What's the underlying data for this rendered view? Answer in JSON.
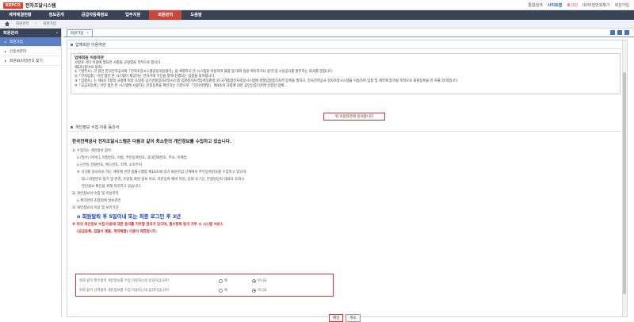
{
  "header": {
    "logo_badge": "KEPCO",
    "logo_text": "전자조달시스템",
    "integrated_search": "통합검색",
    "sitemap": "사이트맵",
    "login": "로그인",
    "find_id": "ID/비밀번호찾기",
    "join": "회원가입"
  },
  "gnb": [
    {
      "label": "계약체결현황"
    },
    {
      "label": "정보공개"
    },
    {
      "label": "공급자등록정보"
    },
    {
      "label": "업무지원"
    },
    {
      "label": "회원관리"
    },
    {
      "label": "도움말"
    }
  ],
  "breadcrumb": {
    "level1": "회원관리",
    "level2": "회원가입"
  },
  "sidebar": {
    "title": "회원관리",
    "items": [
      {
        "label": "회원가입"
      },
      {
        "label": "인증서관리"
      },
      {
        "label": "회원ID/비밀번호 찾기"
      }
    ]
  },
  "tab": {
    "label": "회원가입",
    "close": "✕"
  },
  "terms_section": {
    "title": "업체회원 이용약관",
    "body_title": "업체회원 이용약관",
    "lines": [
      "사항과 기타 이용에 필요한 사항을 규정함을 목적으로 합니다.",
      "제2조(용어의 정의)",
      "①「발주사」라 함은 한국전력공사와「전자조달시스템공동이용협약」을 체결하고 본 시스템을 이용하여 물품 및 대화 용용 획득하거나 용역 및 시설공사를 발주하는 회사를 말합니다.",
      "②「전자입찰」이란 협은 본 시스템이 제공하는 전자거래 수단을 통해 진행되는 입찰을 의미합니다.",
      "③「입찰자」는 제4조 5항의 규정에 따라 조달청 공기관용업자조달시스템 입찰참가자격등록등판정 외 국가종합전자조달시스템에 경쟁입찰참가자격 등록을 필하고, 한국전력공사 전자조달시스템을 이용하여 입찰 및 계약에 참가될 목적으로 회원등록을 한 자를 의미합니다.",
      "④「공급자등록」이란 협은 본 시스템에 사용자는 인증등록을 확인하는 기준으로 「전자서명법」 제4조의 규정에 의한 공인인증기관에 인증된 업체..."
    ],
    "agree_button": "위 이용약관에 동의합니다"
  },
  "privacy_section": {
    "title": "개인정보 수집·이용 동의서",
    "lead": "한국전력공사 전자조달시스템은 다음과 같이 최소한의 개인정보를 수집하고 있습니다.",
    "items": [
      {
        "text": "1) 수집하는 개인정보 항목",
        "level": 0
      },
      {
        "text": "o (필수) 아이디, 비밀번호, 이름, 주민등록번호, 휴대전화번호, 주소, 이메일",
        "level": 1
      },
      {
        "text": "o (선택) 전화번호, 팩스번호, 직책, 소속부서",
        "level": 1
      },
      {
        "text": "※ 국가를 당사자로 하는 계약에 관한 법률시행령 제16조에 의거 회원가입 단계에서 주민등록번호를 수집하고 있으며,",
        "level": 1
      },
      {
        "text": "ID / 비밀번호 찾기 및 변경, 조달청 회원 정보 비교, 자문등록 예비 처리, 상세 로그인, 본정담당자 대표자 조회시",
        "level": 2
      },
      {
        "text": "본인정보 확인을 위해 처리하고 있습니다.",
        "level": 2
      },
      {
        "text": "2) 개인정보의 수집 및 이용목적",
        "level": 0
      },
      {
        "text": "o 계약관련 조달업체 정보관리",
        "level": 1
      },
      {
        "text": "3) 개인정보의 이용 및 보유기간",
        "level": 0
      }
    ],
    "retention": "o 회원탈퇴 후 5일이내 또는 최종 로그인 후 3년",
    "warn1": "※ 위의 개인정보 수집·이용에 대한 동의를 거부할 권리가 있으며, 필수항목 동의 거부 시 시스템 서비스",
    "warn2": "(공급등록, 입찰서 제출, 계약체결) 이용이 제한됩니다."
  },
  "consent": [
    {
      "question": "위와 같이 필수항목 개인정보를 수집·이용하는데 동의하십니까?",
      "yes": "예",
      "no": "아니요",
      "selected": "no"
    },
    {
      "question": "위와 같이 선택항목 개인정보를 수집·이용하는데 동의하십니까?",
      "yes": "예",
      "no": "아니요",
      "selected": "no"
    }
  ],
  "buttons": {
    "confirm": "확인",
    "cancel": "취소"
  },
  "colors": {
    "gnb_bg": "#3b4457",
    "gnb_active": "#c9463d",
    "sidebar_active": "#5b7fc5",
    "highlight": "#e03030",
    "emphasis_blue": "#1a3fc4"
  }
}
